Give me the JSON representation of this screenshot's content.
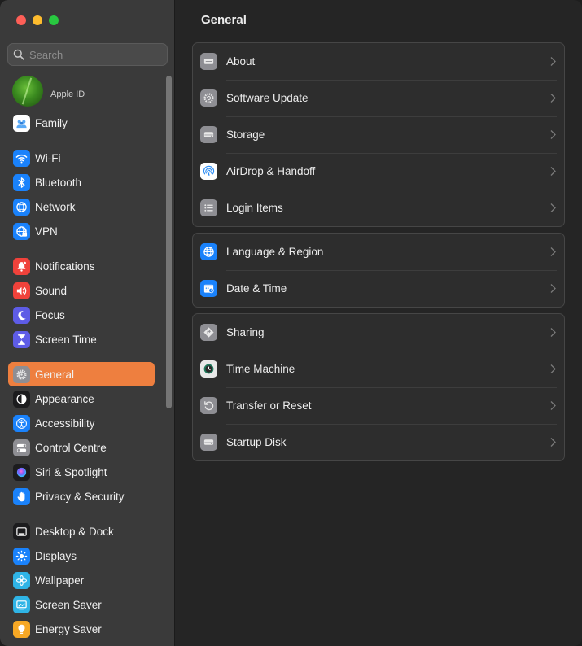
{
  "search": {
    "placeholder": "Search"
  },
  "appleid": {
    "label": "Apple ID"
  },
  "sidebar": {
    "items": [
      {
        "label": "Family",
        "icon": "family-icon",
        "color": "#ffffff"
      },
      {
        "label": "Wi-Fi",
        "icon": "wifi-icon",
        "color": "#1a82fb"
      },
      {
        "label": "Bluetooth",
        "icon": "bluetooth-icon",
        "color": "#1a82fb"
      },
      {
        "label": "Network",
        "icon": "globe-icon",
        "color": "#1a82fb"
      },
      {
        "label": "VPN",
        "icon": "vpn-icon",
        "color": "#1a82fb"
      },
      {
        "label": "Notifications",
        "icon": "bell-icon",
        "color": "#f0423b"
      },
      {
        "label": "Sound",
        "icon": "speaker-icon",
        "color": "#f0423b"
      },
      {
        "label": "Focus",
        "icon": "moon-icon",
        "color": "#5e5ce6"
      },
      {
        "label": "Screen Time",
        "icon": "hourglass-icon",
        "color": "#5e5ce6"
      },
      {
        "label": "General",
        "icon": "gear-icon",
        "color": "#8e8e93",
        "selected": true
      },
      {
        "label": "Appearance",
        "icon": "appearance-icon",
        "color": "#1c1c1e"
      },
      {
        "label": "Accessibility",
        "icon": "accessibility-icon",
        "color": "#1a82fb"
      },
      {
        "label": "Control Centre",
        "icon": "toggles-icon",
        "color": "#8e8e93"
      },
      {
        "label": "Siri & Spotlight",
        "icon": "siri-icon",
        "color": "#1c1c1e"
      },
      {
        "label": "Privacy & Security",
        "icon": "hand-icon",
        "color": "#1a82fb"
      },
      {
        "label": "Desktop & Dock",
        "icon": "dock-icon",
        "color": "#1c1c1e"
      },
      {
        "label": "Displays",
        "icon": "sun-icon",
        "color": "#1a82fb"
      },
      {
        "label": "Wallpaper",
        "icon": "flower-icon",
        "color": "#2fb4e6"
      },
      {
        "label": "Screen Saver",
        "icon": "screensaver-icon",
        "color": "#2fb4e6"
      },
      {
        "label": "Energy Saver",
        "icon": "bulb-icon",
        "color": "#f7a825"
      }
    ]
  },
  "main": {
    "title": "General",
    "groups": [
      [
        {
          "label": "About",
          "icon": "computer-icon"
        },
        {
          "label": "Software Update",
          "icon": "update-gear-icon"
        },
        {
          "label": "Storage",
          "icon": "drive-icon"
        },
        {
          "label": "AirDrop & Handoff",
          "icon": "airdrop-icon"
        },
        {
          "label": "Login Items",
          "icon": "list-icon"
        }
      ],
      [
        {
          "label": "Language & Region",
          "icon": "globe-icon"
        },
        {
          "label": "Date & Time",
          "icon": "calendar-clock-icon"
        }
      ],
      [
        {
          "label": "Sharing",
          "icon": "sharing-icon"
        },
        {
          "label": "Time Machine",
          "icon": "time-machine-icon"
        },
        {
          "label": "Transfer or Reset",
          "icon": "reset-icon"
        },
        {
          "label": "Startup Disk",
          "icon": "disk-icon"
        }
      ]
    ]
  }
}
